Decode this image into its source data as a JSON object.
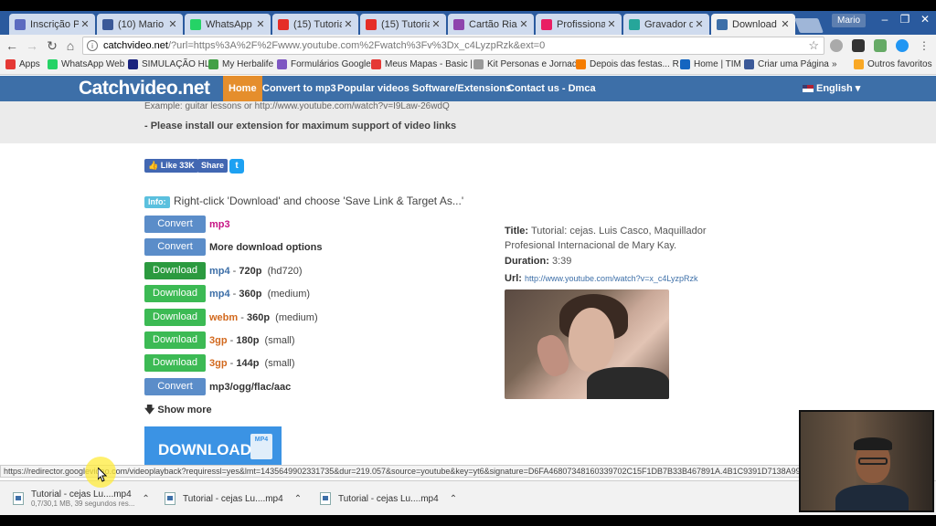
{
  "browser": {
    "tabs": [
      {
        "title": "Inscrição Pr...",
        "color": "#5c6bc0"
      },
      {
        "title": "(10) Mario T...",
        "color": "#3b5998"
      },
      {
        "title": "WhatsApp",
        "color": "#25d366"
      },
      {
        "title": "(15) Tutorial...",
        "color": "#e52d27"
      },
      {
        "title": "(15) Tutorial...",
        "color": "#e52d27"
      },
      {
        "title": "Cartão Riach...",
        "color": "#8e44ad"
      },
      {
        "title": "Profissional...",
        "color": "#e91e63"
      },
      {
        "title": "Gravador de...",
        "color": "#26a69a"
      },
      {
        "title": "Download o...",
        "color": "#3d6fa8"
      }
    ],
    "profile_name": "Mario",
    "url_host": "catchvideo.net",
    "url_rest": "/?url=https%3A%2F%2Fwww.youtube.com%2Fwatch%3Fv%3Dx_c4LyzpRzk&ext=0",
    "bookmarks": [
      {
        "label": "Apps",
        "color": "#e53935"
      },
      {
        "label": "WhatsApp Web",
        "color": "#25d366"
      },
      {
        "label": "SIMULAÇÃO HL",
        "color": "#1a237e"
      },
      {
        "label": "My Herbalife",
        "color": "#43a047"
      },
      {
        "label": "Formulários Google",
        "color": "#7e57c2"
      },
      {
        "label": "Meus Mapas - Basic |",
        "color": "#e53935"
      },
      {
        "label": "Kit Personas e Jornad",
        "color": "#999999"
      },
      {
        "label": "Depois das festas... R",
        "color": "#f57c00"
      },
      {
        "label": "Home | TIM",
        "color": "#1565c0"
      },
      {
        "label": "Criar uma Página",
        "color": "#3b5998"
      },
      {
        "label": "Outros favoritos",
        "color": "#f9a825"
      }
    ]
  },
  "site": {
    "logo": "Catchvideo.net",
    "nav": [
      "Home",
      "Convert to mp3",
      "Popular videos",
      "Software/Extensions",
      "Contact us - Dmca"
    ],
    "language": "English",
    "example_text": "Example: guitar lessons or http://www.youtube.com/watch?v=I9Law-26wdQ",
    "install_note": "- Please install our extension for maximum support of video links",
    "like_label": "Like 33K",
    "share_label": "Share",
    "info_badge": "Info:",
    "info_text": "Right-click 'Download' and choose 'Save Link & Target As...'"
  },
  "options": [
    {
      "button": "Convert",
      "type": "convert",
      "format": "mp3",
      "format_color": "#c71585",
      "resolution": "",
      "quality": ""
    },
    {
      "button": "Convert",
      "type": "convert",
      "format": "More download options",
      "format_color": "#333333",
      "resolution": "",
      "quality": ""
    },
    {
      "button": "Download",
      "type": "download-dark",
      "format": "mp4",
      "format_color": "#3d6fa8",
      "resolution": "720p",
      "quality": "(hd720)"
    },
    {
      "button": "Download",
      "type": "download",
      "format": "mp4",
      "format_color": "#3d6fa8",
      "resolution": "360p",
      "quality": "(medium)"
    },
    {
      "button": "Download",
      "type": "download",
      "format": "webm",
      "format_color": "#d2691e",
      "resolution": "360p",
      "quality": "(medium)"
    },
    {
      "button": "Download",
      "type": "download",
      "format": "3gp",
      "format_color": "#d2691e",
      "resolution": "180p",
      "quality": "(small)"
    },
    {
      "button": "Download",
      "type": "download",
      "format": "3gp",
      "format_color": "#d2691e",
      "resolution": "144p",
      "quality": "(small)"
    },
    {
      "button": "Convert",
      "type": "convert",
      "format": "mp3/ogg/flac/aac",
      "format_color": "#333333",
      "resolution": "",
      "quality": ""
    }
  ],
  "show_more": "Show more",
  "big_download": "DOWNLOAD",
  "big_download_filetype": "MP4",
  "video": {
    "title_label": "Title:",
    "title": "Tutorial: cejas. Luis Casco, Maquillador Profesional Internacional de Mary Kay.",
    "duration_label": "Duration:",
    "duration": "3:39",
    "url_label": "Url:",
    "url": "http://www.youtube.com/watch?v=x_c4LyzpRzk"
  },
  "status_url": "https://redirector.googlevideo.com/videoplayback?requiressl=yes&lmt=1435649902331735&dur=219.057&source=youtube&key=yt6&signature=D6FA46807348160339702C15F1DB7B33B467891A.4B1C9391D7138A99C",
  "downloads": [
    {
      "name": "Tutorial - cejas Lu....mp4",
      "sub": "0,7/30,1 MB, 39 segundos res..."
    },
    {
      "name": "Tutorial - cejas Lu....mp4",
      "sub": ""
    },
    {
      "name": "Tutorial - cejas Lu....mp4",
      "sub": ""
    }
  ]
}
